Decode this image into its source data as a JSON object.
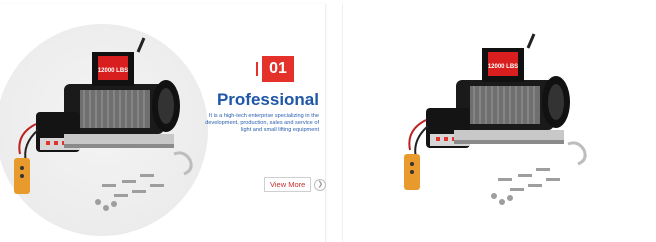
{
  "feature": {
    "number": "01",
    "title": "Professional",
    "description": "It is a high-tech enterprise specializing in the development, production, sales and service of light and small lifting equipment",
    "view_more_label": "View More"
  },
  "product": {
    "motor_label": "12000 LBS"
  },
  "colors": {
    "accent_red": "#e4322b",
    "heading_blue": "#1e56a8",
    "remote_orange": "#e89a2c"
  }
}
